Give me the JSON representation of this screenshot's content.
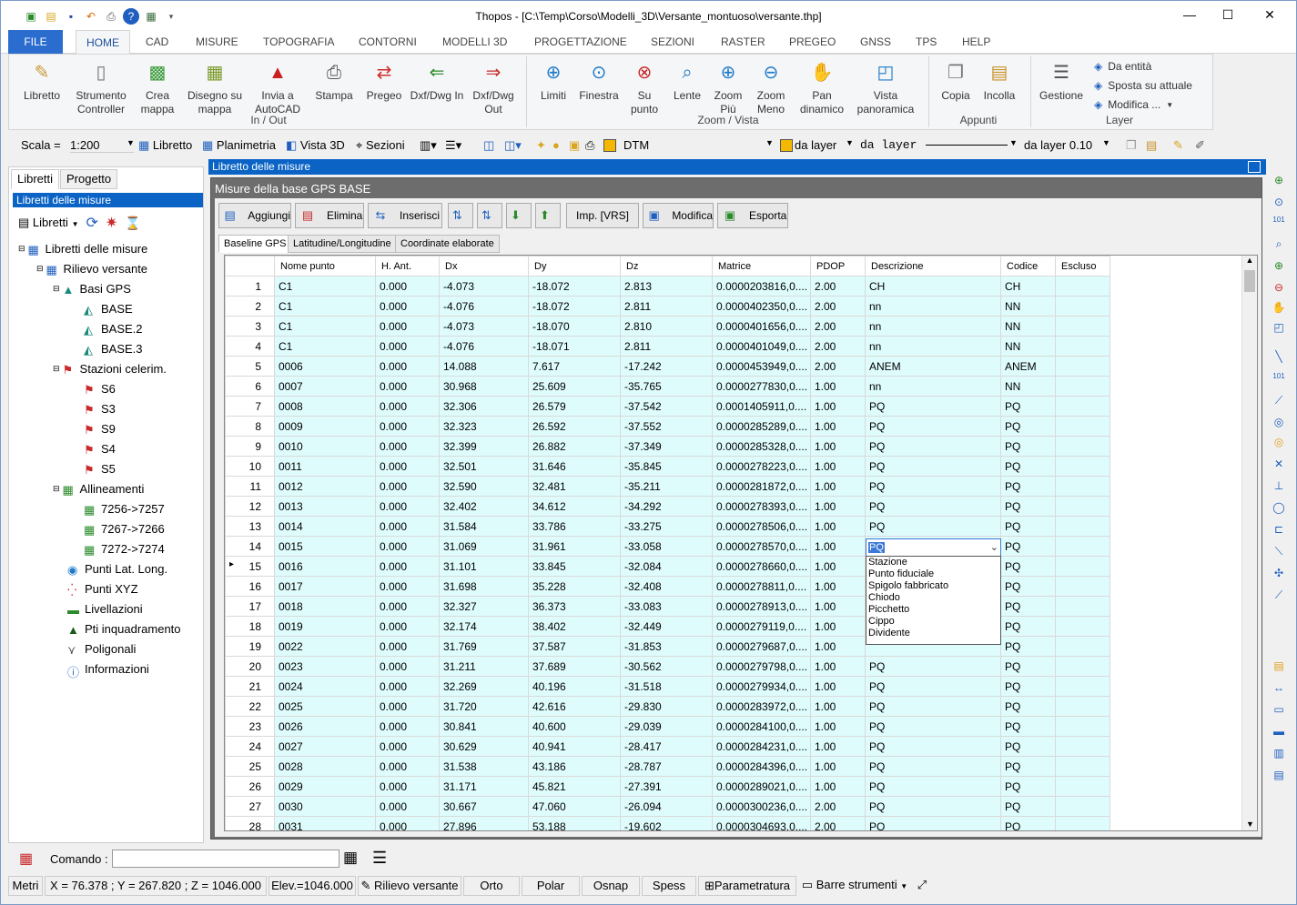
{
  "window": {
    "title": "Thopos - [C:\\Temp\\Corso\\Modelli_3D\\Versante_montuoso\\versante.thp]"
  },
  "menu": [
    "FILE",
    "HOME",
    "CAD",
    "MISURE",
    "TOPOGRAFIA",
    "CONTORNI",
    "MODELLI 3D",
    "PROGETTAZIONE",
    "SEZIONI",
    "RASTER",
    "PREGEO",
    "GNSS",
    "TPS",
    "HELP"
  ],
  "ribbon": {
    "inout": [
      "Libretto",
      "Strumento Controller",
      "Crea mappa",
      "Disegno su mappa",
      "Invia a AutoCAD",
      "Stampa",
      "Pregeo",
      "Dxf/Dwg In",
      "Dxf/Dwg Out"
    ],
    "inout_group": "In / Out",
    "zoom": [
      "Limiti",
      "Finestra",
      "Su punto",
      "Lente",
      "Zoom Più",
      "Zoom Meno",
      "Pan dinamico",
      "Vista panoramica"
    ],
    "zoom_group": "Zoom / Vista",
    "appunti": [
      "Copia",
      "Incolla"
    ],
    "appunti_group": "Appunti",
    "layer": [
      "Gestione",
      "Da entità",
      "Sposta su attuale",
      "Modifica ..."
    ],
    "layer_group": "Layer"
  },
  "toolbar2": {
    "scala_label": "Scala =",
    "scala_value": "1:200",
    "libretto": "Libretto",
    "planimetria": "Planimetria",
    "vista3d": "Vista 3D",
    "sezioni": "Sezioni",
    "dtm": "DTM",
    "layer1": "da layer",
    "layer2": "da layer",
    "layer3": "da layer 0.10"
  },
  "left": {
    "tabs": [
      "Libretti",
      "Progetto"
    ],
    "header": "Libretti delle misure",
    "tool_libretti": "Libretti",
    "tree": {
      "root": "Libretti delle misure",
      "rilievo": "Rilievo versante",
      "basi": "Basi GPS",
      "basi_items": [
        "BASE",
        "BASE.2",
        "BASE.3"
      ],
      "stazioni": "Stazioni celerim.",
      "stazioni_items": [
        "S6",
        "S3",
        "S9",
        "S4",
        "S5"
      ],
      "allineamenti": "Allineamenti",
      "allin_items": [
        "7256->7257",
        "7267->7266",
        "7272->7274"
      ],
      "others": [
        "Punti Lat. Long.",
        "Punti XYZ",
        "Livellazioni",
        "Pti inquadramento",
        "Poligonali",
        "Informazioni"
      ]
    }
  },
  "main": {
    "title": "Libretto delle misure",
    "subtitle": "Misure della base GPS BASE",
    "actions": [
      "Aggiungi",
      "Elimina",
      "Inserisci",
      "Imp. [VRS]",
      "Modifica",
      "Esporta"
    ],
    "tabs": [
      "Baseline GPS",
      "Latitudine/Longitudine",
      "Coordinate elaborate"
    ],
    "columns": [
      "Nome punto",
      "H. Ant.",
      "Dx",
      "Dy",
      "Dz",
      "Matrice",
      "PDOP",
      "Descrizione",
      "Codice",
      "Escluso"
    ],
    "rows": [
      [
        "1",
        "C1",
        "0.000",
        "-4.073",
        "-18.072",
        "2.813",
        "0.0000203816,0....",
        "2.00",
        "CH",
        "CH"
      ],
      [
        "2",
        "C1",
        "0.000",
        "-4.076",
        "-18.072",
        "2.811",
        "0.0000402350,0....",
        "2.00",
        "nn",
        "NN"
      ],
      [
        "3",
        "C1",
        "0.000",
        "-4.073",
        "-18.070",
        "2.810",
        "0.0000401656,0....",
        "2.00",
        "nn",
        "NN"
      ],
      [
        "4",
        "C1",
        "0.000",
        "-4.076",
        "-18.071",
        "2.811",
        "0.0000401049,0....",
        "2.00",
        "nn",
        "NN"
      ],
      [
        "5",
        "0006",
        "0.000",
        "14.088",
        "7.617",
        "-17.242",
        "0.0000453949,0....",
        "2.00",
        "ANEM",
        "ANEM"
      ],
      [
        "6",
        "0007",
        "0.000",
        "30.968",
        "25.609",
        "-35.765",
        "0.0000277830,0....",
        "1.00",
        "nn",
        "NN"
      ],
      [
        "7",
        "0008",
        "0.000",
        "32.306",
        "26.579",
        "-37.542",
        "0.0001405911,0....",
        "1.00",
        "PQ",
        "PQ"
      ],
      [
        "8",
        "0009",
        "0.000",
        "32.323",
        "26.592",
        "-37.552",
        "0.0000285289,0....",
        "1.00",
        "PQ",
        "PQ"
      ],
      [
        "9",
        "0010",
        "0.000",
        "32.399",
        "26.882",
        "-37.349",
        "0.0000285328,0....",
        "1.00",
        "PQ",
        "PQ"
      ],
      [
        "10",
        "0011",
        "0.000",
        "32.501",
        "31.646",
        "-35.845",
        "0.0000278223,0....",
        "1.00",
        "PQ",
        "PQ"
      ],
      [
        "11",
        "0012",
        "0.000",
        "32.590",
        "32.481",
        "-35.211",
        "0.0000281872,0....",
        "1.00",
        "PQ",
        "PQ"
      ],
      [
        "12",
        "0013",
        "0.000",
        "32.402",
        "34.612",
        "-34.292",
        "0.0000278393,0....",
        "1.00",
        "PQ",
        "PQ"
      ],
      [
        "13",
        "0014",
        "0.000",
        "31.584",
        "33.786",
        "-33.275",
        "0.0000278506,0....",
        "1.00",
        "PQ",
        "PQ"
      ],
      [
        "14",
        "0015",
        "0.000",
        "31.069",
        "31.961",
        "-33.058",
        "0.0000278570,0....",
        "1.00",
        "PQ",
        "PQ"
      ],
      [
        "15",
        "0016",
        "0.000",
        "31.101",
        "33.845",
        "-32.084",
        "0.0000278660,0....",
        "1.00",
        "",
        "PQ"
      ],
      [
        "16",
        "0017",
        "0.000",
        "31.698",
        "35.228",
        "-32.408",
        "0.0000278811,0....",
        "1.00",
        "",
        "PQ"
      ],
      [
        "17",
        "0018",
        "0.000",
        "32.327",
        "36.373",
        "-33.083",
        "0.0000278913,0....",
        "1.00",
        "",
        "PQ"
      ],
      [
        "18",
        "0019",
        "0.000",
        "32.174",
        "38.402",
        "-32.449",
        "0.0000279119,0....",
        "1.00",
        "",
        "PQ"
      ],
      [
        "19",
        "0022",
        "0.000",
        "31.769",
        "37.587",
        "-31.853",
        "0.0000279687,0....",
        "1.00",
        "",
        "PQ"
      ],
      [
        "20",
        "0023",
        "0.000",
        "31.211",
        "37.689",
        "-30.562",
        "0.0000279798,0....",
        "1.00",
        "PQ",
        "PQ"
      ],
      [
        "21",
        "0024",
        "0.000",
        "32.269",
        "40.196",
        "-31.518",
        "0.0000279934,0....",
        "1.00",
        "PQ",
        "PQ"
      ],
      [
        "22",
        "0025",
        "0.000",
        "31.720",
        "42.616",
        "-29.830",
        "0.0000283972,0....",
        "1.00",
        "PQ",
        "PQ"
      ],
      [
        "23",
        "0026",
        "0.000",
        "30.841",
        "40.600",
        "-29.039",
        "0.0000284100,0....",
        "1.00",
        "PQ",
        "PQ"
      ],
      [
        "24",
        "0027",
        "0.000",
        "30.629",
        "40.941",
        "-28.417",
        "0.0000284231,0....",
        "1.00",
        "PQ",
        "PQ"
      ],
      [
        "25",
        "0028",
        "0.000",
        "31.538",
        "43.186",
        "-28.787",
        "0.0000284396,0....",
        "1.00",
        "PQ",
        "PQ"
      ],
      [
        "26",
        "0029",
        "0.000",
        "31.171",
        "45.821",
        "-27.391",
        "0.0000289021,0....",
        "1.00",
        "PQ",
        "PQ"
      ],
      [
        "27",
        "0030",
        "0.000",
        "30.667",
        "47.060",
        "-26.094",
        "0.0000300236,0....",
        "2.00",
        "PQ",
        "PQ"
      ],
      [
        "28",
        "0031",
        "0.000",
        "27.896",
        "53.188",
        "-19.602",
        "0.0000304693,0....",
        "2.00",
        "PQ",
        "PQ"
      ]
    ],
    "editing_value": "PQ",
    "dropdown_options": [
      "Stazione",
      "Punto fiduciale",
      "Spigolo fabbricato",
      "Chiodo",
      "Picchetto",
      "Cippo",
      "Dividente"
    ]
  },
  "command": {
    "label": "Comando :"
  },
  "status": {
    "unit": "Metri",
    "coords": "X = 76.378 ; Y = 267.820 ; Z = 1046.000",
    "elev": "Elev.=1046.000",
    "rilievo": "Rilievo versante",
    "orto": "Orto",
    "polar": "Polar",
    "osnap": "Osnap",
    "spess": "Spess",
    "param": "Parametratura",
    "barre": "Barre strumenti"
  }
}
